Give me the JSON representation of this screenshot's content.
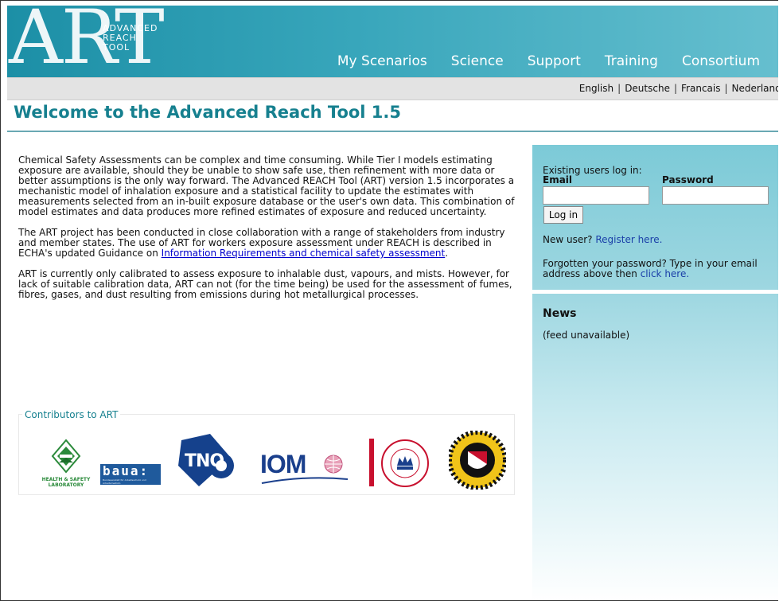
{
  "header": {
    "logo_text": "ART",
    "logo_sub": [
      "Advanced",
      "Reach",
      "Tool"
    ],
    "nav": [
      "My Scenarios",
      "Science",
      "Support",
      "Training",
      "Consortium"
    ]
  },
  "languages": [
    "English",
    "Deutsche",
    "Francais",
    "Nederlands"
  ],
  "page_title": "Welcome to the Advanced Reach Tool 1.5",
  "content": {
    "p1": "Chemical Safety Assessments can be complex and time consuming. While Tier I models estimating exposure are available, should they be unable to show safe use, then refinement with more data or better assumptions is the only way forward. The Advanced REACH Tool (ART) version 1.5 incorporates a mechanistic model of inhalation exposure and a statistical facility to update the estimates with measurements selected from an in-built exposure database or the user's own data. This combination of model estimates and data produces more refined estimates of exposure and reduced uncertainty.",
    "p2_before": "The ART project has been conducted in close collaboration with a range of stakeholders from industry and member states. The use of ART for workers exposure assessment under REACH is described in ECHA's updated Guidance on ",
    "p2_link": "Information Requirements and chemical safety assessment",
    "p2_after": ".",
    "p3": "ART is currently only calibrated to assess exposure to inhalable dust, vapours, and mists. However, for lack of suitable calibration data, ART can not (for the time being) be used for the assessment of fumes, fibres, gases, and dust resulting from emissions during hot metallurgical processes."
  },
  "contributors": {
    "label": "Contributors to ART",
    "hsl": [
      "HEALTH & SAFETY",
      "LABORATORY"
    ],
    "baua": "baua:",
    "baua_sub": "Bundesanstalt für Arbeitsschutz und Arbeitsmedizin",
    "tno": "TNO",
    "iom": "IOM"
  },
  "login": {
    "intro": "Existing users log in:",
    "email_label": "Email",
    "password_label": "Password",
    "button": "Log in",
    "new_user": "New user? ",
    "register_link": "Register here.",
    "forgot": "Forgotten your password? Type in your email address above then ",
    "click_here": "click here."
  },
  "news": {
    "title": "News",
    "feed": "(feed unavailable)"
  },
  "colors": {
    "accent": "#16808f",
    "header_start": "#1c8fa6",
    "header_end": "#66bfcf",
    "sidebar": "#7ccad7",
    "link": "#0000cc"
  }
}
